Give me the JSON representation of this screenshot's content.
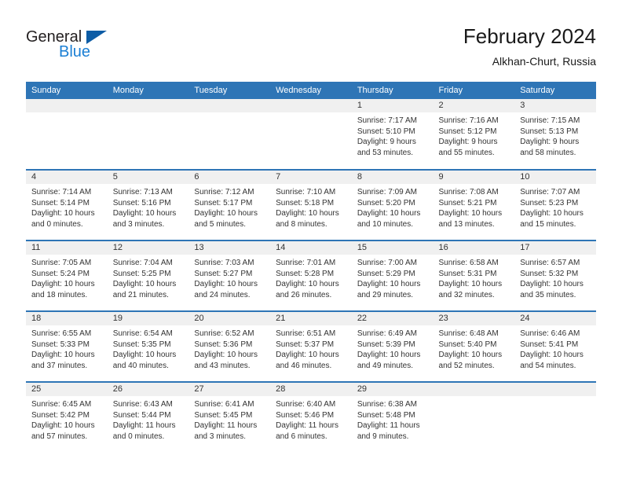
{
  "brand": {
    "line1": "General",
    "line2": "Blue",
    "triangle_icon": "triangle-logo-icon",
    "accent_color": "#1b7fd4",
    "triangle_color": "#0d5ca5"
  },
  "header": {
    "title": "February 2024",
    "subtitle": "Alkhan-Churt, Russia"
  },
  "theme": {
    "header_blue": "#2e75b6",
    "band_gray": "#f0f0f0",
    "text": "#333333"
  },
  "weekday_headers": [
    "Sunday",
    "Monday",
    "Tuesday",
    "Wednesday",
    "Thursday",
    "Friday",
    "Saturday"
  ],
  "weeks": [
    [
      {
        "day": "",
        "sunrise": "",
        "sunset": "",
        "daylight1": "",
        "daylight2": ""
      },
      {
        "day": "",
        "sunrise": "",
        "sunset": "",
        "daylight1": "",
        "daylight2": ""
      },
      {
        "day": "",
        "sunrise": "",
        "sunset": "",
        "daylight1": "",
        "daylight2": ""
      },
      {
        "day": "",
        "sunrise": "",
        "sunset": "",
        "daylight1": "",
        "daylight2": ""
      },
      {
        "day": "1",
        "sunrise": "Sunrise: 7:17 AM",
        "sunset": "Sunset: 5:10 PM",
        "daylight1": "Daylight: 9 hours",
        "daylight2": "and 53 minutes."
      },
      {
        "day": "2",
        "sunrise": "Sunrise: 7:16 AM",
        "sunset": "Sunset: 5:12 PM",
        "daylight1": "Daylight: 9 hours",
        "daylight2": "and 55 minutes."
      },
      {
        "day": "3",
        "sunrise": "Sunrise: 7:15 AM",
        "sunset": "Sunset: 5:13 PM",
        "daylight1": "Daylight: 9 hours",
        "daylight2": "and 58 minutes."
      }
    ],
    [
      {
        "day": "4",
        "sunrise": "Sunrise: 7:14 AM",
        "sunset": "Sunset: 5:14 PM",
        "daylight1": "Daylight: 10 hours",
        "daylight2": "and 0 minutes."
      },
      {
        "day": "5",
        "sunrise": "Sunrise: 7:13 AM",
        "sunset": "Sunset: 5:16 PM",
        "daylight1": "Daylight: 10 hours",
        "daylight2": "and 3 minutes."
      },
      {
        "day": "6",
        "sunrise": "Sunrise: 7:12 AM",
        "sunset": "Sunset: 5:17 PM",
        "daylight1": "Daylight: 10 hours",
        "daylight2": "and 5 minutes."
      },
      {
        "day": "7",
        "sunrise": "Sunrise: 7:10 AM",
        "sunset": "Sunset: 5:18 PM",
        "daylight1": "Daylight: 10 hours",
        "daylight2": "and 8 minutes."
      },
      {
        "day": "8",
        "sunrise": "Sunrise: 7:09 AM",
        "sunset": "Sunset: 5:20 PM",
        "daylight1": "Daylight: 10 hours",
        "daylight2": "and 10 minutes."
      },
      {
        "day": "9",
        "sunrise": "Sunrise: 7:08 AM",
        "sunset": "Sunset: 5:21 PM",
        "daylight1": "Daylight: 10 hours",
        "daylight2": "and 13 minutes."
      },
      {
        "day": "10",
        "sunrise": "Sunrise: 7:07 AM",
        "sunset": "Sunset: 5:23 PM",
        "daylight1": "Daylight: 10 hours",
        "daylight2": "and 15 minutes."
      }
    ],
    [
      {
        "day": "11",
        "sunrise": "Sunrise: 7:05 AM",
        "sunset": "Sunset: 5:24 PM",
        "daylight1": "Daylight: 10 hours",
        "daylight2": "and 18 minutes."
      },
      {
        "day": "12",
        "sunrise": "Sunrise: 7:04 AM",
        "sunset": "Sunset: 5:25 PM",
        "daylight1": "Daylight: 10 hours",
        "daylight2": "and 21 minutes."
      },
      {
        "day": "13",
        "sunrise": "Sunrise: 7:03 AM",
        "sunset": "Sunset: 5:27 PM",
        "daylight1": "Daylight: 10 hours",
        "daylight2": "and 24 minutes."
      },
      {
        "day": "14",
        "sunrise": "Sunrise: 7:01 AM",
        "sunset": "Sunset: 5:28 PM",
        "daylight1": "Daylight: 10 hours",
        "daylight2": "and 26 minutes."
      },
      {
        "day": "15",
        "sunrise": "Sunrise: 7:00 AM",
        "sunset": "Sunset: 5:29 PM",
        "daylight1": "Daylight: 10 hours",
        "daylight2": "and 29 minutes."
      },
      {
        "day": "16",
        "sunrise": "Sunrise: 6:58 AM",
        "sunset": "Sunset: 5:31 PM",
        "daylight1": "Daylight: 10 hours",
        "daylight2": "and 32 minutes."
      },
      {
        "day": "17",
        "sunrise": "Sunrise: 6:57 AM",
        "sunset": "Sunset: 5:32 PM",
        "daylight1": "Daylight: 10 hours",
        "daylight2": "and 35 minutes."
      }
    ],
    [
      {
        "day": "18",
        "sunrise": "Sunrise: 6:55 AM",
        "sunset": "Sunset: 5:33 PM",
        "daylight1": "Daylight: 10 hours",
        "daylight2": "and 37 minutes."
      },
      {
        "day": "19",
        "sunrise": "Sunrise: 6:54 AM",
        "sunset": "Sunset: 5:35 PM",
        "daylight1": "Daylight: 10 hours",
        "daylight2": "and 40 minutes."
      },
      {
        "day": "20",
        "sunrise": "Sunrise: 6:52 AM",
        "sunset": "Sunset: 5:36 PM",
        "daylight1": "Daylight: 10 hours",
        "daylight2": "and 43 minutes."
      },
      {
        "day": "21",
        "sunrise": "Sunrise: 6:51 AM",
        "sunset": "Sunset: 5:37 PM",
        "daylight1": "Daylight: 10 hours",
        "daylight2": "and 46 minutes."
      },
      {
        "day": "22",
        "sunrise": "Sunrise: 6:49 AM",
        "sunset": "Sunset: 5:39 PM",
        "daylight1": "Daylight: 10 hours",
        "daylight2": "and 49 minutes."
      },
      {
        "day": "23",
        "sunrise": "Sunrise: 6:48 AM",
        "sunset": "Sunset: 5:40 PM",
        "daylight1": "Daylight: 10 hours",
        "daylight2": "and 52 minutes."
      },
      {
        "day": "24",
        "sunrise": "Sunrise: 6:46 AM",
        "sunset": "Sunset: 5:41 PM",
        "daylight1": "Daylight: 10 hours",
        "daylight2": "and 54 minutes."
      }
    ],
    [
      {
        "day": "25",
        "sunrise": "Sunrise: 6:45 AM",
        "sunset": "Sunset: 5:42 PM",
        "daylight1": "Daylight: 10 hours",
        "daylight2": "and 57 minutes."
      },
      {
        "day": "26",
        "sunrise": "Sunrise: 6:43 AM",
        "sunset": "Sunset: 5:44 PM",
        "daylight1": "Daylight: 11 hours",
        "daylight2": "and 0 minutes."
      },
      {
        "day": "27",
        "sunrise": "Sunrise: 6:41 AM",
        "sunset": "Sunset: 5:45 PM",
        "daylight1": "Daylight: 11 hours",
        "daylight2": "and 3 minutes."
      },
      {
        "day": "28",
        "sunrise": "Sunrise: 6:40 AM",
        "sunset": "Sunset: 5:46 PM",
        "daylight1": "Daylight: 11 hours",
        "daylight2": "and 6 minutes."
      },
      {
        "day": "29",
        "sunrise": "Sunrise: 6:38 AM",
        "sunset": "Sunset: 5:48 PM",
        "daylight1": "Daylight: 11 hours",
        "daylight2": "and 9 minutes."
      },
      {
        "day": "",
        "sunrise": "",
        "sunset": "",
        "daylight1": "",
        "daylight2": ""
      },
      {
        "day": "",
        "sunrise": "",
        "sunset": "",
        "daylight1": "",
        "daylight2": ""
      }
    ]
  ]
}
